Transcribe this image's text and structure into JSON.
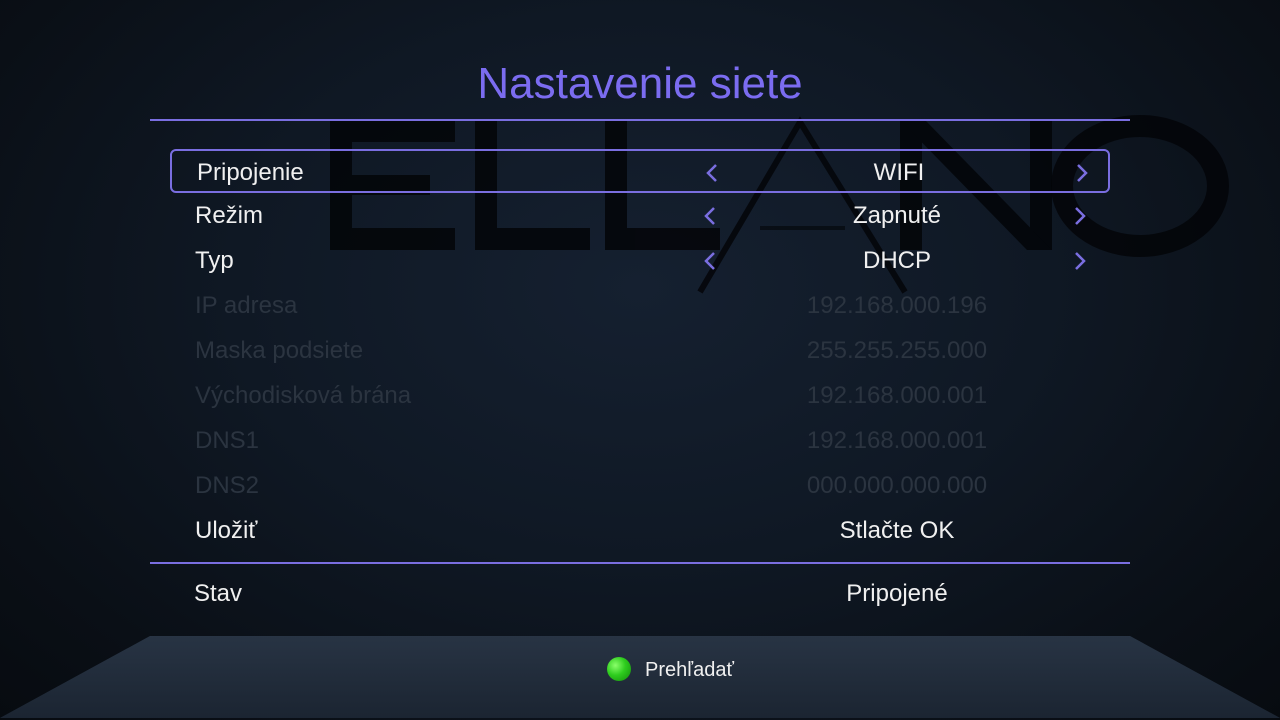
{
  "title": "Nastavenie siete",
  "watermark": "ELLANO",
  "rows": [
    {
      "label": "Pripojenie",
      "value": "WIFI"
    },
    {
      "label": "Režim",
      "value": "Zapnuté"
    },
    {
      "label": "Typ",
      "value": "DHCP"
    },
    {
      "label": "IP adresa",
      "value": "192.168.000.196"
    },
    {
      "label": "Maska podsiete",
      "value": "255.255.255.000"
    },
    {
      "label": "Východisková brána",
      "value": "192.168.000.001"
    },
    {
      "label": "DNS1",
      "value": "192.168.000.001"
    },
    {
      "label": "DNS2",
      "value": "000.000.000.000"
    },
    {
      "label": "Uložiť",
      "value": "Stlačte OK"
    }
  ],
  "selected_row": "Pripojenie",
  "status": {
    "label": "Stav",
    "value": "Pripojené"
  },
  "footer": {
    "search_label": "Prehľadať",
    "search_key_color": "green",
    "search_icon": "green-button-icon"
  },
  "colors": {
    "accent": "#7a6ee0",
    "title": "#7b6cf0",
    "text": "#f0f0f0",
    "disabled_text": "#2b3440",
    "background": "#0f1824"
  }
}
